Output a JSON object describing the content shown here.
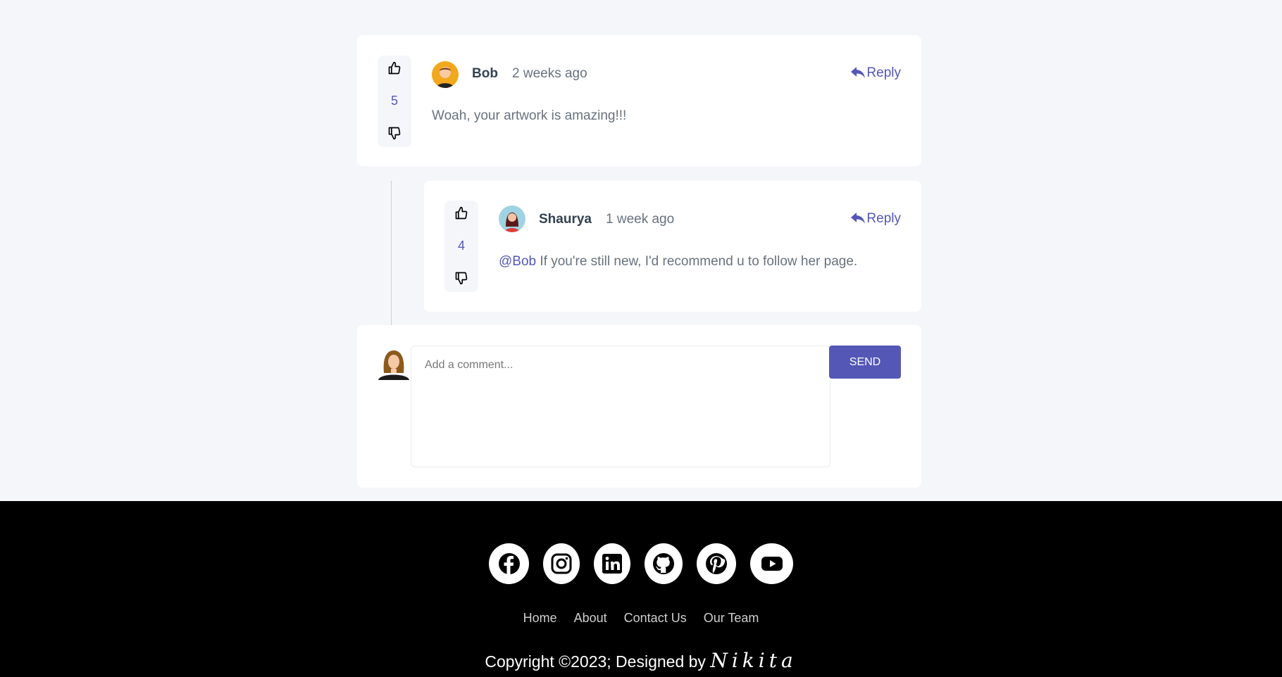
{
  "comments": [
    {
      "user": "Bob",
      "time": "2 weeks ago",
      "score": "5",
      "text": "Woah, your artwork is amazing!!!",
      "reply_label": "Reply"
    }
  ],
  "replies": [
    {
      "user": "Shaurya",
      "time": "1 week ago",
      "score": "4",
      "mention": "@Bob",
      "text": " If you're still new, I'd recommend u to follow her page.",
      "reply_label": "Reply"
    }
  ],
  "composer": {
    "placeholder": "Add a comment...",
    "send_label": "SEND"
  },
  "footer": {
    "socials": [
      "facebook-icon",
      "instagram-icon",
      "linkedin-icon",
      "github-icon",
      "pinterest-icon",
      "youtube-icon"
    ],
    "links": [
      "Home",
      "About",
      "Contact Us",
      "Our Team"
    ],
    "copyright": "Copyright ©2023; Designed by ",
    "designer": "Nikita"
  },
  "colors": {
    "accent": "#5457b6",
    "page_bg": "#f5f6fa",
    "footer_bg": "#000000",
    "name": "#334253",
    "muted": "#67727e"
  }
}
